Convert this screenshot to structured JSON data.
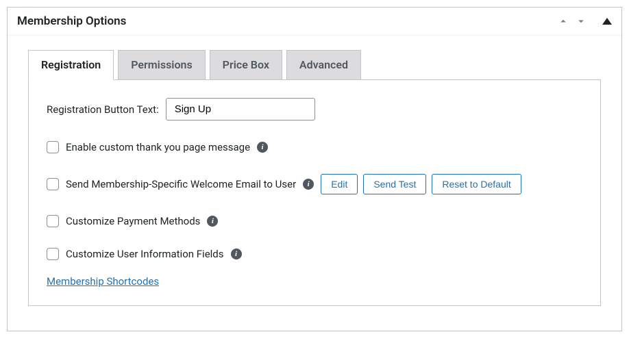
{
  "panel": {
    "title": "Membership Options"
  },
  "tabs": {
    "registration": "Registration",
    "permissions": "Permissions",
    "pricebox": "Price Box",
    "advanced": "Advanced"
  },
  "registration": {
    "button_text_label": "Registration Button Text:",
    "button_text_value": "Sign Up",
    "thankyou_label": "Enable custom thank you page message",
    "welcome_email_label": "Send Membership-Specific Welcome Email to User",
    "edit_button": "Edit",
    "send_test_button": "Send Test",
    "reset_button": "Reset to Default",
    "payment_methods_label": "Customize Payment Methods",
    "user_info_label": "Customize User Information Fields",
    "shortcodes_link": "Membership Shortcodes"
  }
}
